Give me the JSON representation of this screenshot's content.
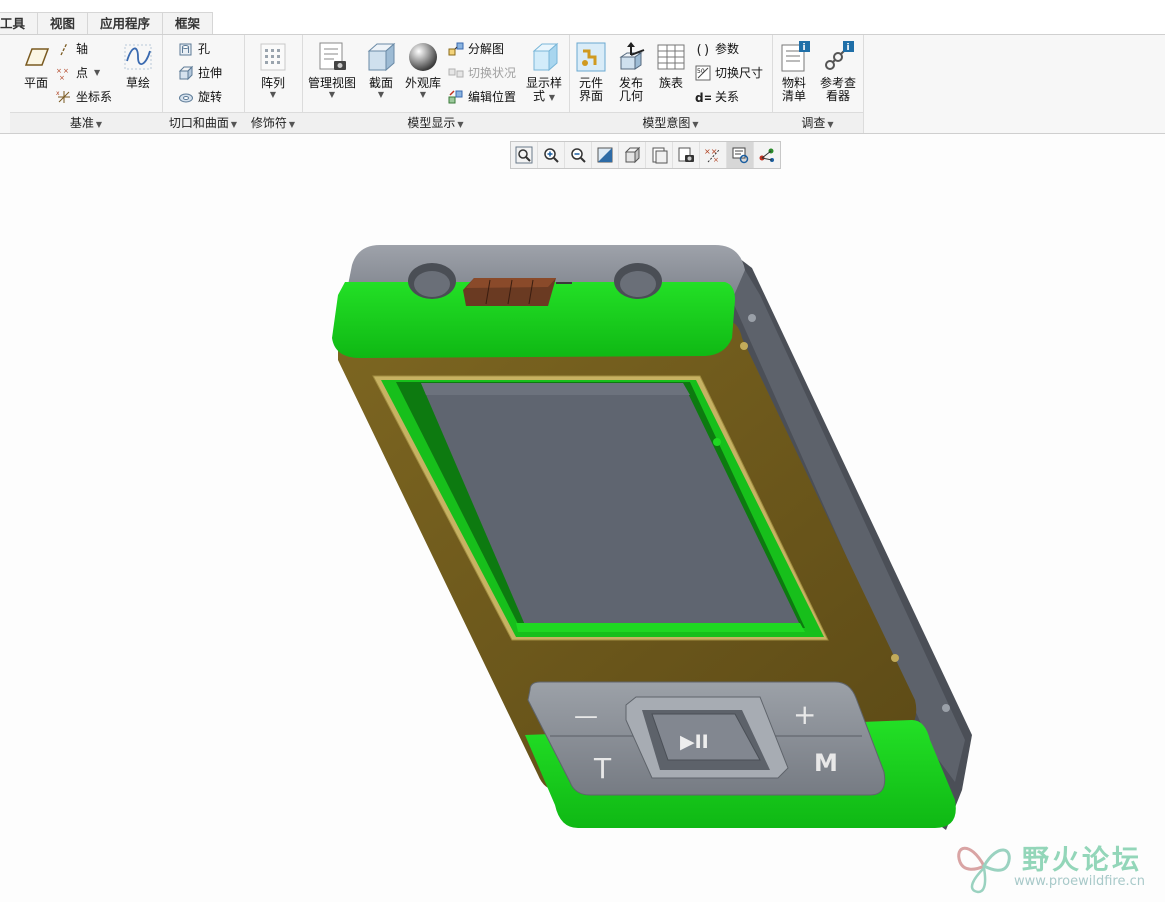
{
  "menu_tabs": [
    "工具",
    "视图",
    "应用程序",
    "框架"
  ],
  "ribbon": {
    "datum": {
      "group_label": "基准",
      "plane": "平面",
      "axis": "轴",
      "point": "点",
      "csys": "坐标系",
      "sketch": "草绘"
    },
    "cut_surface": {
      "group_label": "切口和曲面",
      "hole": "孔",
      "extrude": "拉伸",
      "revolve": "旋转"
    },
    "modifiers": {
      "group_label": "修饰符",
      "pattern": "阵列"
    },
    "model_display": {
      "group_label": "模型显示",
      "manage_views": "管理视图",
      "section": "截面",
      "appearance": "外观库",
      "exploded_view": "分解图",
      "toggle_status": "切换状况",
      "edit_position": "编辑位置",
      "display_style_1": "显示样",
      "display_style_2": "式"
    },
    "model_intent": {
      "group_label": "模型意图",
      "component_interface_1": "元件",
      "component_interface_2": "界面",
      "publish_geometry_1": "发布",
      "publish_geometry_2": "几何",
      "family_table": "族表",
      "parameters": "参数",
      "switch_dimensions": "切换尺寸",
      "relations": "关系"
    },
    "investigate": {
      "group_label": "调查",
      "bom_1": "物料",
      "bom_2": "清单",
      "ref_viewer_1": "参考查",
      "ref_viewer_2": "看器"
    }
  },
  "device": {
    "key_minus": "—",
    "key_plus": "+",
    "key_t": "T",
    "key_m": "M",
    "key_play": "▶II"
  },
  "watermark": {
    "title": "野火论坛",
    "url": "www.proewildfire.cn"
  },
  "colors": {
    "ribbon_bg": "#f7f7f7",
    "shell_green": "#19d81c",
    "frame_gold": "#6e5a1c",
    "screen_gray": "#5f6570",
    "top_gray": "#8d9199",
    "button_pad": "#8e9399"
  }
}
